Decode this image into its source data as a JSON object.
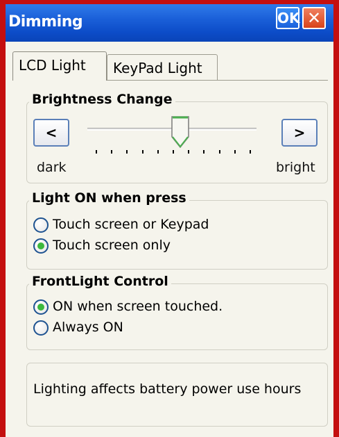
{
  "window": {
    "title": "Dimming",
    "ok_label": "OK",
    "close_label": "✕"
  },
  "tabs": [
    {
      "label": "LCD Light",
      "active": true
    },
    {
      "label": "KeyPad Light",
      "active": false
    }
  ],
  "brightness": {
    "group_title": "Brightness Change",
    "decrease_label": "<",
    "increase_label": ">",
    "min_label": "dark",
    "max_label": "bright",
    "level": 0.55,
    "ticks": 11
  },
  "light_on": {
    "group_title": "Light ON when press",
    "options": [
      {
        "label": "Touch screen or Keypad",
        "selected": false
      },
      {
        "label": "Touch screen only",
        "selected": true
      }
    ]
  },
  "frontlight": {
    "group_title": "FrontLight Control",
    "options": [
      {
        "label": "ON when screen touched.",
        "selected": true
      },
      {
        "label": "Always ON",
        "selected": false
      }
    ]
  },
  "info": {
    "text": "Lighting affects battery power use hours"
  },
  "colors": {
    "titlebar": "#0c4cc8",
    "frame": "#c40f0f",
    "radio_on": "#3db83d"
  }
}
